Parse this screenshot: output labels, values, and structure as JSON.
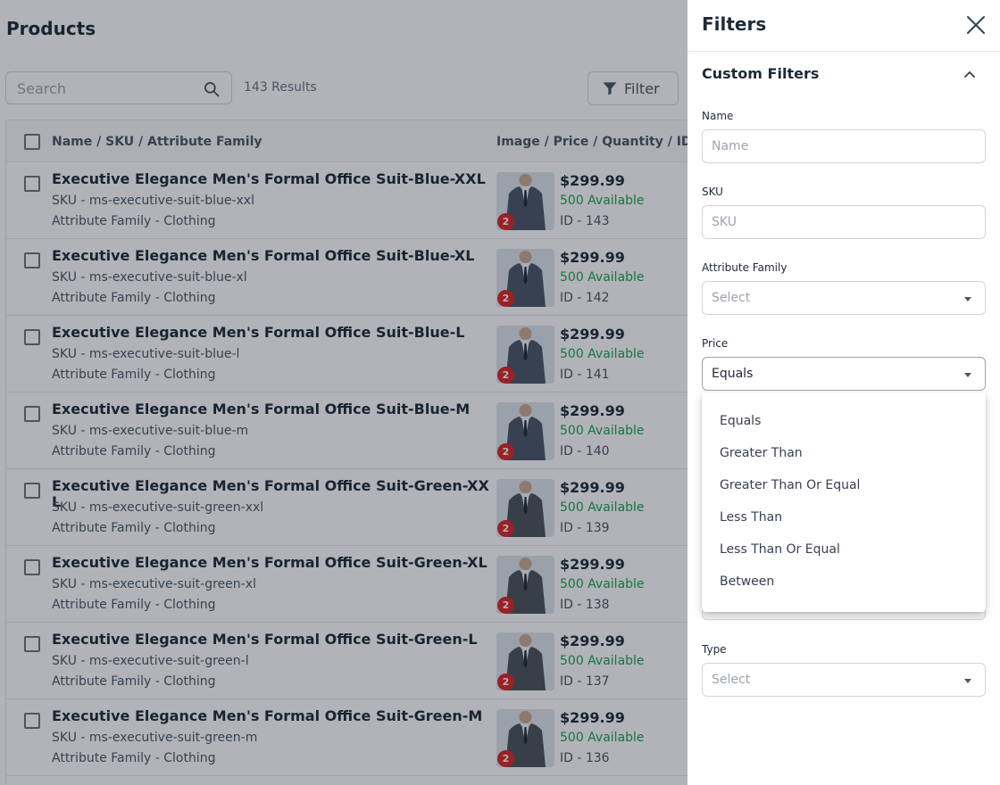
{
  "page": {
    "title": "Products"
  },
  "search": {
    "placeholder": "Search"
  },
  "toolbar": {
    "results": "143 Results",
    "filter_label": "Filter"
  },
  "grid": {
    "headers": [
      "Name / SKU / Attribute Family",
      "Image / Price / Quantity / ID"
    ],
    "rows": [
      {
        "name": "Executive Elegance Men's Formal Office Suit-Blue-XXL",
        "sku": "SKU - ms-executive-suit-blue-xxl",
        "family": "Attribute Family - Clothing",
        "images": "2",
        "price": "$299.99",
        "qty": "500 Available",
        "id": "ID - 143",
        "suit_color": "#4a5568"
      },
      {
        "name": "Executive Elegance Men's Formal Office Suit-Blue-XL",
        "sku": "SKU - ms-executive-suit-blue-xl",
        "family": "Attribute Family - Clothing",
        "images": "2",
        "price": "$299.99",
        "qty": "500 Available",
        "id": "ID - 142",
        "suit_color": "#4a5568"
      },
      {
        "name": "Executive Elegance Men's Formal Office Suit-Blue-L",
        "sku": "SKU - ms-executive-suit-blue-l",
        "family": "Attribute Family - Clothing",
        "images": "2",
        "price": "$299.99",
        "qty": "500 Available",
        "id": "ID - 141",
        "suit_color": "#4a5568"
      },
      {
        "name": "Executive Elegance Men's Formal Office Suit-Blue-M",
        "sku": "SKU - ms-executive-suit-blue-m",
        "family": "Attribute Family - Clothing",
        "images": "2",
        "price": "$299.99",
        "qty": "500 Available",
        "id": "ID - 140",
        "suit_color": "#4a5568"
      },
      {
        "name": "Executive Elegance Men's Formal Office Suit-Green-XXL",
        "sku": "SKU - ms-executive-suit-green-xxl",
        "family": "Attribute Family - Clothing",
        "images": "2",
        "price": "$299.99",
        "qty": "500 Available",
        "id": "ID - 139",
        "suit_color": "#4b5258"
      },
      {
        "name": "Executive Elegance Men's Formal Office Suit-Green-XL",
        "sku": "SKU - ms-executive-suit-green-xl",
        "family": "Attribute Family - Clothing",
        "images": "2",
        "price": "$299.99",
        "qty": "500 Available",
        "id": "ID - 138",
        "suit_color": "#4b5258"
      },
      {
        "name": "Executive Elegance Men's Formal Office Suit-Green-L",
        "sku": "SKU - ms-executive-suit-green-l",
        "family": "Attribute Family - Clothing",
        "images": "2",
        "price": "$299.99",
        "qty": "500 Available",
        "id": "ID - 137",
        "suit_color": "#4b5258"
      },
      {
        "name": "Executive Elegance Men's Formal Office Suit-Green-M",
        "sku": "SKU - ms-executive-suit-green-m",
        "family": "Attribute Family - Clothing",
        "images": "2",
        "price": "$299.99",
        "qty": "500 Available",
        "id": "ID - 136",
        "suit_color": "#4b5258"
      }
    ]
  },
  "filters": {
    "title": "Filters",
    "section_title": "Custom Filters",
    "name": {
      "label": "Name",
      "placeholder": "Name"
    },
    "sku": {
      "label": "SKU",
      "placeholder": "SKU"
    },
    "attribute_family": {
      "label": "Attribute Family",
      "value": "Select"
    },
    "price": {
      "label": "Price",
      "value": "Equals"
    },
    "type": {
      "label": "Type",
      "value": "Select"
    },
    "price_options": [
      "Equals",
      "Greater Than",
      "Greater Than Or Equal",
      "Less Than",
      "Less Than Or Equal",
      "Between"
    ]
  },
  "colors": {
    "accent_green": "#16a34a",
    "badge_red": "#dc2626",
    "overlay": "rgba(17,24,39,0.33)"
  },
  "icons": {
    "search": "search-icon",
    "filter": "filter-icon",
    "close": "close-icon",
    "collapse": "chevron-up-icon",
    "dropdown": "caret-down-icon"
  }
}
